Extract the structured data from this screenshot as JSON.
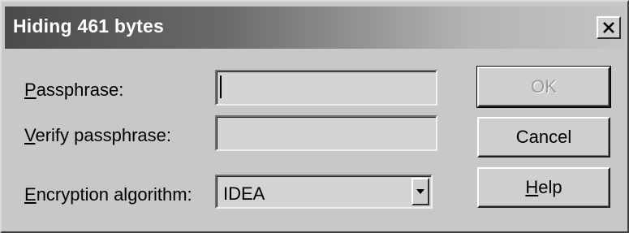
{
  "dialog": {
    "title": "Hiding 461 bytes",
    "close_glyph": "close-icon"
  },
  "form": {
    "passphrase": {
      "label_accel": "P",
      "label_rest": "assphrase:",
      "value": ""
    },
    "verify": {
      "label_accel": "V",
      "label_rest": "erify passphrase:",
      "value": ""
    },
    "algorithm": {
      "label_accel": "E",
      "label_rest": "ncryption algorithm:",
      "selected": "IDEA"
    }
  },
  "buttons": {
    "ok": {
      "label": "OK",
      "disabled": true
    },
    "cancel": {
      "label": "Cancel"
    },
    "help": {
      "label_accel": "H",
      "label_rest": "elp"
    }
  }
}
